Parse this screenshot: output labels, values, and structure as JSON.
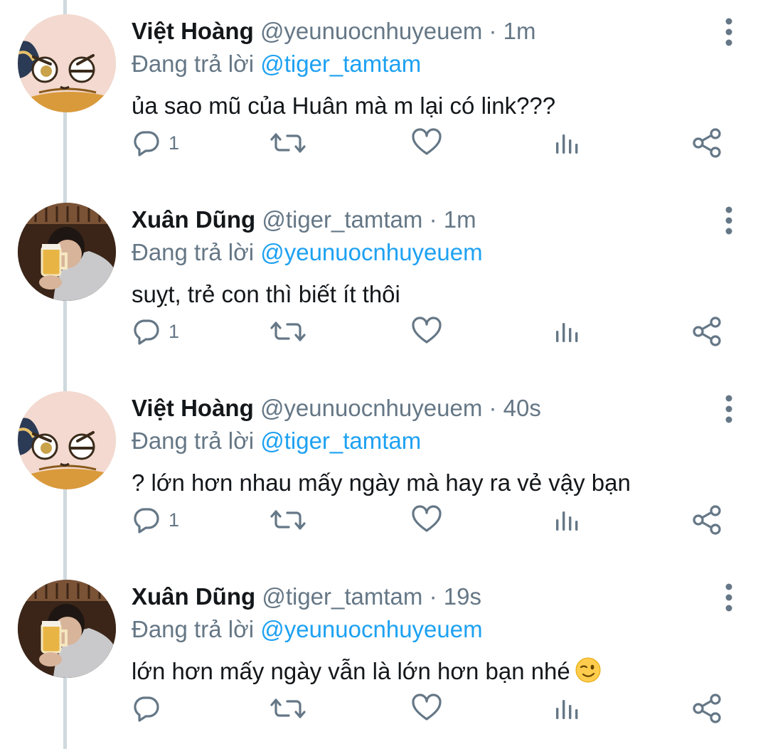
{
  "tweets": [
    {
      "name": "Việt Hoàng",
      "handle": "@yeunuocnhuyeuem",
      "time": "· 1m",
      "reply_prefix": "Đang trả lời",
      "reply_to": "@tiger_tamtam",
      "text": "ủa sao mũ của Huân mà m lại có link???",
      "reply_count": "1",
      "avatar": "cartoon-avatar"
    },
    {
      "name": "Xuân Dũng",
      "handle": "@tiger_tamtam",
      "time": "· 1m",
      "reply_prefix": "Đang trả lời",
      "reply_to": "@yeunuocnhuyeuem",
      "text": "suỵt, trẻ con thì biết ít thôi",
      "reply_count": "1",
      "avatar": "photo-avatar"
    },
    {
      "name": "Việt Hoàng",
      "handle": "@yeunuocnhuyeuem",
      "time": "· 40s",
      "reply_prefix": "Đang trả lời",
      "reply_to": "@tiger_tamtam",
      "text": "? lớn hơn nhau mấy ngày mà hay ra vẻ vậy bạn",
      "reply_count": "1",
      "avatar": "cartoon-avatar"
    },
    {
      "name": "Xuân Dũng",
      "handle": "@tiger_tamtam",
      "time": "· 19s",
      "reply_prefix": "Đang trả lời",
      "reply_to": "@yeunuocnhuyeuem",
      "text": "lớn hơn mấy ngày vẫn là lớn hơn bạn nhé",
      "reply_count": "",
      "avatar": "photo-avatar",
      "emoji": "winking-face"
    }
  ],
  "colors": {
    "text": "#14171a",
    "secondary": "#657786",
    "accent": "#1da1f2",
    "thread_line": "#cfd9de"
  },
  "icons": {
    "reply": "reply-icon",
    "retweet": "retweet-icon",
    "like": "heart-icon",
    "stats": "analytics-icon",
    "share": "share-icon",
    "more": "more-vertical-icon"
  }
}
